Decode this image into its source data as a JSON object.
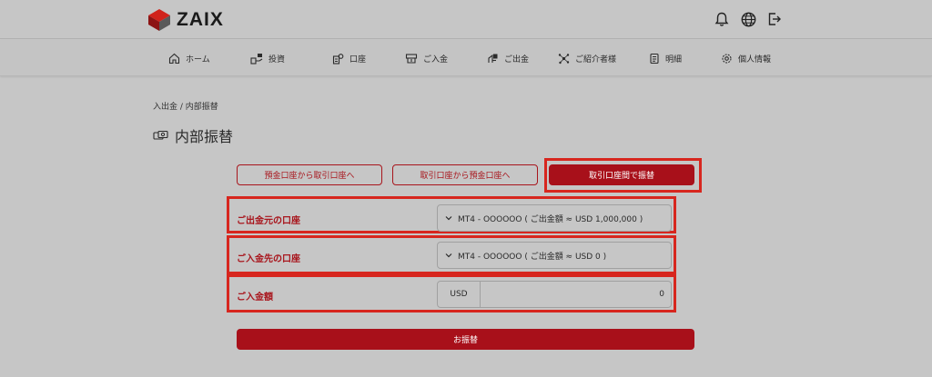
{
  "brand": {
    "name": "ZAIX",
    "accent": "#a8101a",
    "highlight": "#d7261e"
  },
  "header_icons": [
    "bell-icon",
    "globe-icon",
    "logout-icon"
  ],
  "nav": {
    "items": [
      {
        "label": "ホーム",
        "icon": "home-icon"
      },
      {
        "label": "投資",
        "icon": "invest-icon"
      },
      {
        "label": "口座",
        "icon": "account-icon"
      },
      {
        "label": "ご入金",
        "icon": "deposit-icon"
      },
      {
        "label": "ご出金",
        "icon": "withdraw-icon"
      },
      {
        "label": "ご紹介者様",
        "icon": "referral-icon"
      },
      {
        "label": "明細",
        "icon": "statement-icon"
      },
      {
        "label": "個人情報",
        "icon": "gear-icon"
      }
    ]
  },
  "breadcrumb": "入出金 / 内部振替",
  "page_title": "内部振替",
  "tabs": [
    {
      "label": "預金口座から取引口座へ",
      "active": false
    },
    {
      "label": "取引口座から預金口座へ",
      "active": false
    },
    {
      "label": "取引口座間で振替",
      "active": true
    }
  ],
  "form": {
    "from_label": "ご出金元の口座",
    "from_value": "MT4 - OOOOOO ( ご出金額 ≈ USD 1,000,000 )",
    "to_label": "ご入金先の口座",
    "to_value": "MT4 - OOOOOO ( ご出金額 ≈ USD 0 )",
    "amount_label": "ご入金額",
    "amount_unit": "USD",
    "amount_value": "0",
    "submit_label": "お振替"
  }
}
